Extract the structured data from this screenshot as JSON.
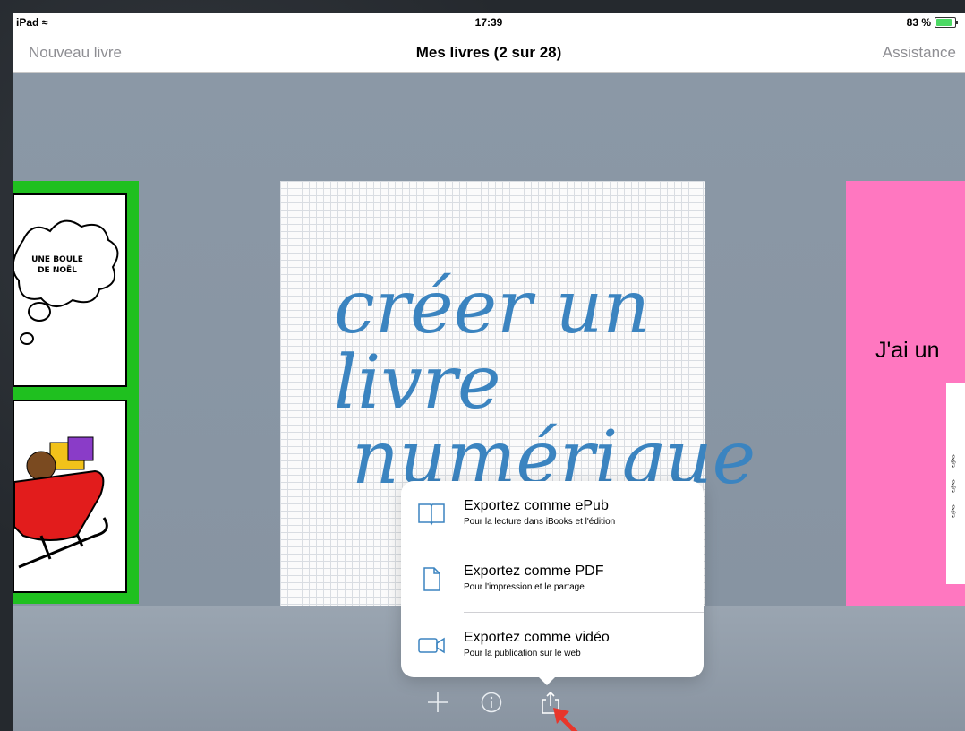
{
  "status_bar": {
    "device": "iPad",
    "time": "17:39",
    "battery": "83 %",
    "battery_level": 0.83
  },
  "nav": {
    "left_button": "Nouveau livre",
    "title": "Mes livres (2 sur 28)",
    "right_button": "Assistance"
  },
  "books": {
    "left": {
      "bubble_text_line1": "UNE BOULE",
      "bubble_text_line2": "DE NOËL",
      "color": "#1fc01f"
    },
    "center": {
      "line1": "créer un",
      "line2": "livre",
      "line3": "numérique"
    },
    "right": {
      "text": "J'ai un",
      "color": "#ff77c0"
    }
  },
  "export_menu": {
    "items": [
      {
        "title": "Exportez comme ePub",
        "subtitle": "Pour la lecture dans iBooks et l'édition",
        "icon": "book-icon"
      },
      {
        "title": "Exportez comme PDF",
        "subtitle": "Pour l'impression et le partage",
        "icon": "document-icon"
      },
      {
        "title": "Exportez comme vidéo",
        "subtitle": "Pour la publication sur le web",
        "icon": "video-camera-icon"
      }
    ]
  },
  "toolbar": {
    "icons": [
      "plus-icon",
      "info-icon",
      "share-icon"
    ]
  },
  "accent_color": "#3b84c0",
  "annotation_color": "#e8362b"
}
